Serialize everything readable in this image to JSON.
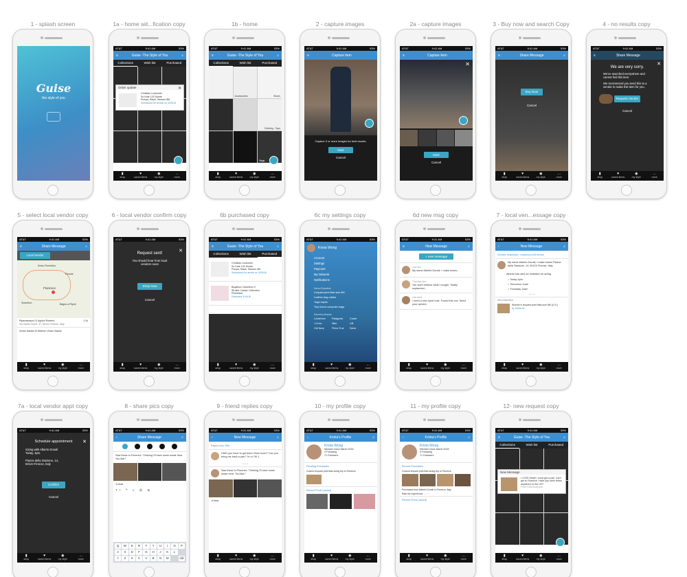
{
  "screens": [
    {
      "caption": "1 - splash screen"
    },
    {
      "caption": "1a - home wit...fication copy"
    },
    {
      "caption": "1b - home"
    },
    {
      "caption": "2 - capture images"
    },
    {
      "caption": "2a - capture images"
    },
    {
      "caption": "3 - Buy now and search Copy"
    },
    {
      "caption": "4 - no results copy"
    },
    {
      "caption": "5 - select local vendor copy"
    },
    {
      "caption": "6 - local vendor confirm copy"
    },
    {
      "caption": "6b purchased copy"
    },
    {
      "caption": "6c my settings copy"
    },
    {
      "caption": "6d new msg copy"
    },
    {
      "caption": "7 - local ven...essage copy"
    },
    {
      "caption": "7a - local vendor appt copy"
    },
    {
      "caption": "8 - share pics copy"
    },
    {
      "caption": "9 - friend replies copy"
    },
    {
      "caption": "10 - my profile copy"
    },
    {
      "caption": "11 - my profile copy"
    },
    {
      "caption": "12- new request copy"
    }
  ],
  "status": {
    "carrier": "AT&T",
    "time": "9:41 AM",
    "battery": "53%"
  },
  "app": {
    "title": "Guise -The Style of You",
    "splash_name": "Guise",
    "splash_tag": "the style of you"
  },
  "tabs": [
    "Collections",
    "Wish list",
    "Purchased"
  ],
  "tabbar": [
    "shop",
    "saved items",
    "my style",
    "more"
  ],
  "capture": {
    "title": "Capture item",
    "hint": "Capture 2 or more images for best results.",
    "next": "Next",
    "cancel": "Cancel"
  },
  "share": {
    "title": "Share Message",
    "buy_now": "Buy Now",
    "cancel": "Cancel"
  },
  "noresults": {
    "heading": "We are very sorry.",
    "body1": "We've searched everywhere and cannot find this item.",
    "body2": "We recommend you send this to a vendor to make this item for you.",
    "request": "Request Vendor",
    "cancel": "Cancel"
  },
  "order": {
    "header": "Order update",
    "line1": "Christian Louboutin",
    "line2": "So Kate 120 Suede",
    "line3": "Pumps, Black, Women 8M",
    "status": "Scheduled for arrival on 3/29/16"
  },
  "home_labels": {
    "accessories": "Accessories",
    "shoes": "Shoes",
    "clothing": "Clothing - Tops",
    "bags": "Bags"
  },
  "vendor": {
    "local_vendor": "Local Vendor",
    "v1": "Riparascarpe Di Ugolini Roberto",
    "v1_addr": "Via Santa Croce, 37, 50122 Firenze, Italy",
    "v1_dist": "1.2k",
    "v2": "Vivian Saskie Di Wittmer Vivian Saskie",
    "city": "Florence",
    "map_labels": [
      "Sesto Fiorentino",
      "Fiesole",
      "Florence",
      "Scandicci",
      "Bagno a Ripoli"
    ]
  },
  "confirm": {
    "title": "Request sent!",
    "body": "You should hear from local vendors soon",
    "shop": "Shop Now",
    "cancel": "Cancel"
  },
  "purchased": {
    "p1_l1": "Christian Louboutin",
    "p1_l2": "So Kate 120 Suede",
    "p1_l3": "Pumps, Black, Women 8M",
    "p1_s": "Scheduled for arrival on 3/29/16",
    "p2_l1": "Bugaboo Cameleon 3",
    "p2_l2": "Stroller Classic Collection",
    "p2_l3": "Pink/black",
    "p2_s": "Delivered 3/19/16"
  },
  "settings": {
    "name": "Krista Wong",
    "items": [
      "Account",
      "Settings",
      "Payment",
      "My Network",
      "Notifications"
    ],
    "saved_header": "Saved Searches",
    "searches": [
      "Leopard print flats size 8M",
      "Leather dog collars",
      "Yoga capris",
      "Tory Burch computer bags"
    ],
    "brands_header": "Saved by Brands",
    "brands": [
      "Lululemon",
      "Patagonia",
      "Coach",
      "J.Crew",
      "Nike",
      "Lilli",
      "Old Navy",
      "Prima True",
      "Sonia"
    ]
  },
  "newmsg": {
    "title": "New Message",
    "button": "+ new message",
    "m1_name": "Just now",
    "m1": "My name Alberto Donali. I make shoes...",
    "m2_name": "Thursday 4pm",
    "m2": "You won't believe what I bought. Totally unplanned...",
    "m3_name": "Last week",
    "m3": "I need a new sport coat. Found this one. Need your opinion"
  },
  "vresp": {
    "header": "Vendor response: Leopard print shoes",
    "intro": "My name Alberto Donali, I make shoes Piazza della Stazione, 14, 50123 Firenze, Italy",
    "invite": "Alberto has sent an invitation for sizing",
    "slots": [
      "Today 4pm",
      "Tomorrow 11am",
      "Thursday 11am"
    ],
    "req_label": "Item requested",
    "req_text": "Women's leopard print flats size 8M (U.S.)",
    "req_by": "by Krista W."
  },
  "appt": {
    "title": "Schedule appointment",
    "line1": "Sizing with Alberto Donali",
    "line2": "Today, 4pm",
    "addr1": "Piazza della Stazione, 14,",
    "addr2": "50123 Firenze, Italy",
    "confirm": "Confirm",
    "cancel": "Cancel"
  },
  "sharepics": {
    "text": "Saw these in Florence. Thinking I'll have some made here. You like?",
    "sign": "-Krista",
    "rows": [
      [
        "Q",
        "W",
        "E",
        "R",
        "T",
        "Y",
        "U",
        "I",
        "O",
        "P"
      ],
      [
        "A",
        "S",
        "D",
        "F",
        "G",
        "H",
        "J",
        "K",
        "L",
        ""
      ],
      [
        "Z",
        "X",
        "C",
        "V",
        "B",
        "N",
        "M",
        "",
        "",
        ""
      ]
    ]
  },
  "reply": {
    "from": "Reply from Elle",
    "r1": "OMG you have to get them! How much? Can you bring me back a pair? I'm a 7M :)",
    "r2": "Saw these in Florence. Thinking I'll have some made here. You like?",
    "sign": "-Krista"
  },
  "profile": {
    "title": "Krista's Profile",
    "name": "Krista Wong",
    "since": "Member since March 2016",
    "following": "4 Following",
    "followers": "71 Followers",
    "pending": "Pending Purchases",
    "pending_text": "Custom leopard print flats sizing trip to Florence",
    "recent": "Recent Finds (saved)",
    "recent_purchases": "Recent Purchases",
    "purchase_note": "Purchased from Alberto Donali in Florence, Italy",
    "rate": "Rate the experience"
  },
  "request": {
    "header": "New Message",
    "msg": "I LOVE these! I must get a pair. Can't get to Florence. Have you seen these anywhere in the US?",
    "from": "From Kelli Anderson"
  }
}
